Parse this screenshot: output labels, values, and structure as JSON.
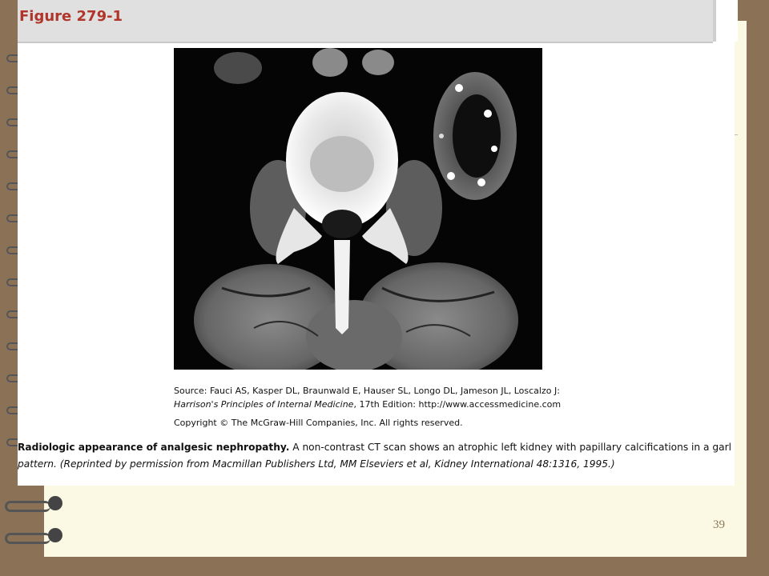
{
  "figure": {
    "title": "Figure 279-1"
  },
  "image": {
    "icon": "ct-scan-image"
  },
  "source": {
    "line1": "Source: Fauci AS, Kasper DL, Braunwald E, Hauser SL, Longo DL, Jameson JL, Loscalzo J:",
    "book": "Harrison's Principles of Internal Medicine",
    "line2_rest": ", 17th Edition: http://www.accessmedicine.com",
    "copyright": "Copyright © The McGraw-Hill Companies, Inc. All rights reserved."
  },
  "caption": {
    "bold": "Radiologic appearance of analgesic nephropathy.",
    "text": " A non-contrast CT scan shows an atrophic left kidney with papillary calcifications in a garland",
    "line2_italic": "pattern. (Reprinted by permission from Macmillan Publishers Ltd, MM Elseviers et al, Kidney International 48:1316, 1995.)"
  },
  "slide": {
    "page_number": "39"
  }
}
